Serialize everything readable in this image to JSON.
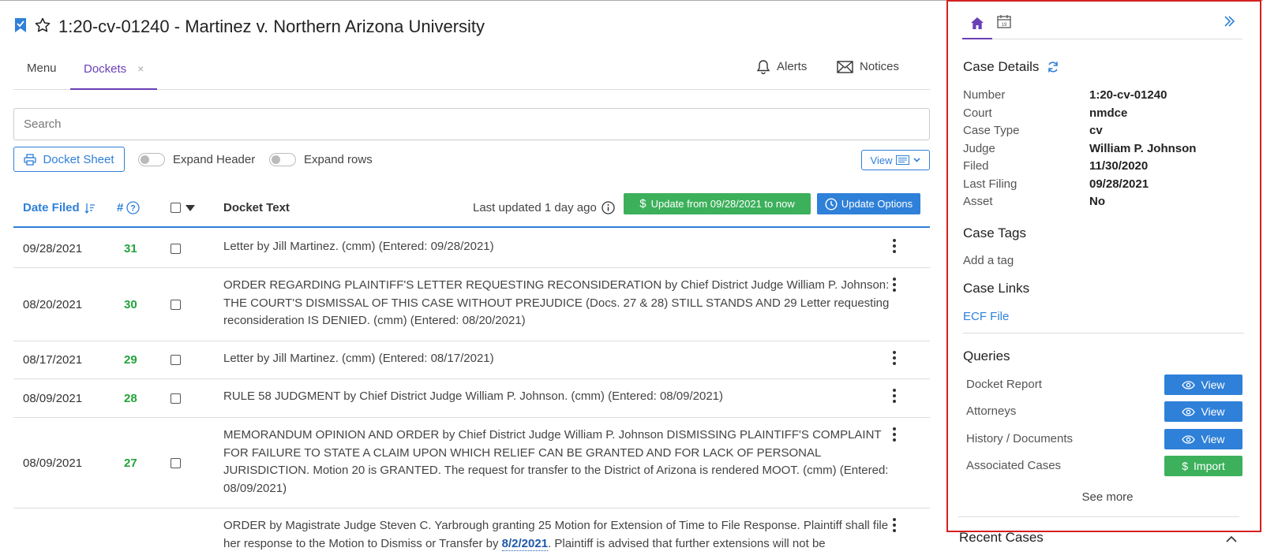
{
  "case_title": "1:20-cv-01240 - Martinez v. Northern Arizona University",
  "tabs": {
    "menu": "Menu",
    "dockets": "Dockets",
    "close": "×"
  },
  "header_actions": {
    "alerts": "Alerts",
    "notices": "Notices"
  },
  "search": {
    "placeholder": "Search",
    "value": ""
  },
  "toolbar": {
    "docket_sheet": "Docket Sheet",
    "expand_header": "Expand Header",
    "expand_rows": "Expand rows",
    "view": "View"
  },
  "table": {
    "headers": {
      "date_filed": "Date Filed",
      "number": "#",
      "docket_text": "Docket Text"
    },
    "last_updated": "Last updated 1 day ago",
    "update_button": "Update from 09/28/2021 to now",
    "update_options": "Update Options",
    "rows": [
      {
        "date": "09/28/2021",
        "num": "31",
        "text": "Letter by Jill Martinez. (cmm) (Entered: 09/28/2021)"
      },
      {
        "date": "08/20/2021",
        "num": "30",
        "text": "ORDER REGARDING PLAINTIFF'S LETTER REQUESTING RECONSIDERATION by Chief District Judge William P. Johnson: THE COURT'S DISMISSAL OF THIS CASE WITHOUT PREJUDICE (Docs. 27 & 28) STILL STANDS AND 29 Letter requesting reconsideration IS DENIED. (cmm) (Entered: 08/20/2021)"
      },
      {
        "date": "08/17/2021",
        "num": "29",
        "text": "Letter by Jill Martinez. (cmm) (Entered: 08/17/2021)"
      },
      {
        "date": "08/09/2021",
        "num": "28",
        "text": "RULE 58 JUDGMENT by Chief District Judge William P. Johnson. (cmm) (Entered: 08/09/2021)"
      },
      {
        "date": "08/09/2021",
        "num": "27",
        "text": "MEMORANDUM OPINION AND ORDER by Chief District Judge William P. Johnson DISMISSING PLAINTIFF'S COMPLAINT FOR FAILURE TO STATE A CLAIM UPON WHICH RELIEF CAN BE GRANTED AND FOR LACK OF PERSONAL JURISDICTION. Motion 20 is GRANTED. The request for transfer to the District of Arizona is rendered MOOT. (cmm) (Entered: 08/09/2021)"
      },
      {
        "date": "",
        "num": "",
        "text_before": "ORDER by Magistrate Judge Steven C. Yarbrough granting 25 Motion for Extension of Time to File Response. Plaintiff shall file her response to the Motion to Dismiss or Transfer by ",
        "text_link": "8/2/2021",
        "text_after": ". Plaintiff is advised that further extensions will not be"
      }
    ]
  },
  "panel": {
    "case_details_title": "Case Details",
    "details": [
      {
        "k": "Number",
        "v": "1:20-cv-01240"
      },
      {
        "k": "Court",
        "v": "nmdce"
      },
      {
        "k": "Case Type",
        "v": "cv"
      },
      {
        "k": "Judge",
        "v": "William P. Johnson"
      },
      {
        "k": "Filed",
        "v": "11/30/2020"
      },
      {
        "k": "Last Filing",
        "v": "09/28/2021"
      },
      {
        "k": "Asset",
        "v": "No"
      }
    ],
    "case_tags_title": "Case Tags",
    "add_tag": "Add a tag",
    "case_links_title": "Case Links",
    "ecf_file": "ECF File",
    "queries_title": "Queries",
    "queries": [
      {
        "label": "Docket Report",
        "button": "View",
        "kind": "view"
      },
      {
        "label": "Attorneys",
        "button": "View",
        "kind": "view"
      },
      {
        "label": "History / Documents",
        "button": "View",
        "kind": "view"
      },
      {
        "label": "Associated Cases",
        "button": "Import",
        "kind": "import"
      }
    ],
    "see_more": "See more",
    "recent_cases": "Recent Cases"
  },
  "colors": {
    "accent_purple": "#6b3fb6",
    "blue": "#2f80d8",
    "green": "#3cb05b",
    "highlight_border": "#d42020"
  }
}
